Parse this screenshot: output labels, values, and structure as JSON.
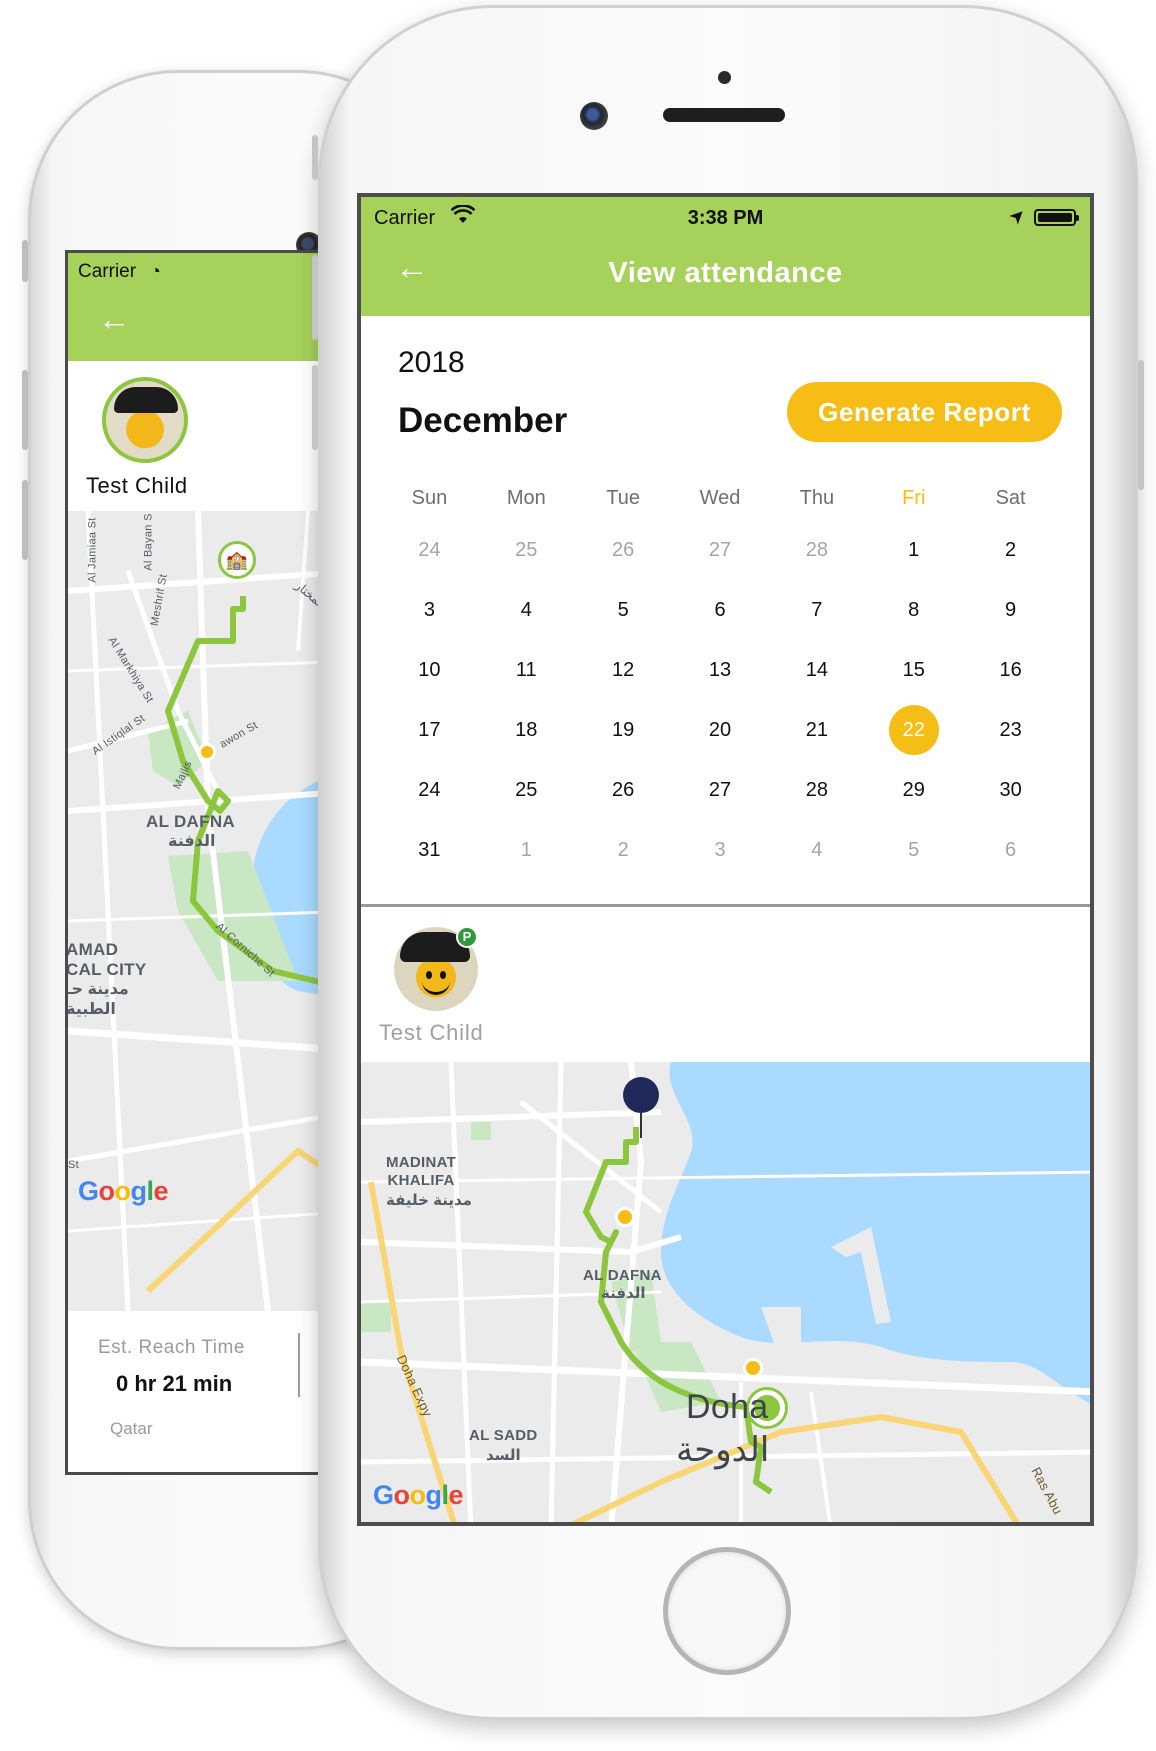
{
  "front_phone": {
    "status_bar": {
      "carrier": "Carrier",
      "time": "3:38 PM",
      "wifi_icon": "wifi-icon",
      "location_icon": "location-arrow-icon",
      "battery_icon": "battery-full-icon"
    },
    "header": {
      "back_icon": "arrow-left-icon",
      "title": "View attendance",
      "color": "#a6d15a"
    },
    "calendar": {
      "year": "2018",
      "month": "December",
      "generate_report_label": "Generate Report",
      "accent_color": "#f6bd16",
      "weekdays": [
        "Sun",
        "Mon",
        "Tue",
        "Wed",
        "Thu",
        "Fri",
        "Sat"
      ],
      "highlighted_weekday": "Fri",
      "selected_day": "22",
      "weeks": [
        [
          {
            "d": "24",
            "m": true
          },
          {
            "d": "25",
            "m": true
          },
          {
            "d": "26",
            "m": true
          },
          {
            "d": "27",
            "m": true
          },
          {
            "d": "28",
            "m": true
          },
          {
            "d": "1"
          },
          {
            "d": "2"
          }
        ],
        [
          {
            "d": "3"
          },
          {
            "d": "4"
          },
          {
            "d": "5"
          },
          {
            "d": "6"
          },
          {
            "d": "7"
          },
          {
            "d": "8"
          },
          {
            "d": "9"
          }
        ],
        [
          {
            "d": "10"
          },
          {
            "d": "11"
          },
          {
            "d": "12"
          },
          {
            "d": "13"
          },
          {
            "d": "14"
          },
          {
            "d": "15"
          },
          {
            "d": "16"
          }
        ],
        [
          {
            "d": "17"
          },
          {
            "d": "18"
          },
          {
            "d": "19"
          },
          {
            "d": "20"
          },
          {
            "d": "21"
          },
          {
            "d": "22",
            "s": true
          },
          {
            "d": "23"
          }
        ],
        [
          {
            "d": "24"
          },
          {
            "d": "25"
          },
          {
            "d": "26"
          },
          {
            "d": "27"
          },
          {
            "d": "28"
          },
          {
            "d": "29"
          },
          {
            "d": "30"
          }
        ],
        [
          {
            "d": "31"
          },
          {
            "d": "1",
            "m": true
          },
          {
            "d": "2",
            "m": true
          },
          {
            "d": "3",
            "m": true
          },
          {
            "d": "4",
            "m": true
          },
          {
            "d": "5",
            "m": true
          },
          {
            "d": "6",
            "m": true
          }
        ]
      ]
    },
    "child": {
      "name": "Test Child",
      "badge": "P",
      "badge_color": "#2d9b3b"
    },
    "map": {
      "labels": {
        "madinat_khalifa_en": "MADINAT\nKHALIFA",
        "madinat_khalifa_ar": "مدينة خليفة",
        "al_dafna_en": "AL DAFNA",
        "al_dafna_ar": "الدفنة",
        "al_sadd_en": "AL SADD",
        "al_sadd_ar": "السد",
        "doha_en": "Doha",
        "doha_ar": "الدوحة",
        "doha_expy": "Doha Expy",
        "ras_abu": "Ras Abu"
      },
      "route_color": "#8cc63f",
      "stop_color": "#f6bd16",
      "destination_pin_color": "#1f2a5a",
      "attribution": "Google"
    }
  },
  "back_phone": {
    "status_bar": {
      "carrier": "Carrier",
      "wifi_icon": "wifi-icon"
    },
    "header": {
      "back_icon": "arrow-left-icon"
    },
    "child": {
      "name": "Test Child"
    },
    "map": {
      "labels": {
        "al_jamiaa": "Al Jamiaa St",
        "al_bayan": "Al Bayan S",
        "meshrif": "Meshrif St",
        "al_markhiya": "Al Markhiya St",
        "al_istiqlal": "Al Istiqlal St",
        "tawon": "awon St",
        "majlis": "Majlis",
        "al_dafna_en": "AL DAFNA",
        "al_dafna_ar": "الدفنة",
        "al_corniche": "Al Corniche St",
        "hamad_line1": "AMAD",
        "hamad_line2": "CAL CITY",
        "hamad_ar1": "مدينة حـ",
        "hamad_ar2": "الطبية",
        "al_mukhtar_ar": "المختار",
        "st_fragment": "St"
      },
      "school_icon": "school-building-icon",
      "attribution": "Google"
    },
    "footer": {
      "eta_label": "Est. Reach Time",
      "eta_value": "0 hr 21 min",
      "country": "Qatar"
    }
  }
}
